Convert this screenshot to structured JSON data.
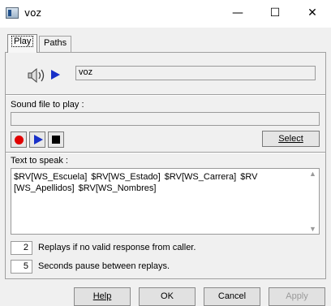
{
  "window": {
    "title": "voz",
    "minimize_glyph": "—",
    "maximize_glyph": "☐",
    "close_glyph": "✕"
  },
  "tabs": [
    {
      "label": "Play",
      "active": true
    },
    {
      "label": "Paths",
      "active": false
    }
  ],
  "play": {
    "speaker_icon": "speaker-icon",
    "name_value": "voz",
    "sound_file_label": "Sound file to play :",
    "sound_file_value": "",
    "select_label": "Select",
    "text_to_speak_label": "Text to speak :",
    "text_to_speak_value": "$RV[WS_Escuela]   $RV[WS_Estado]  $RV[WS_Carrera]  $RV [WS_Apellidos]   $RV[WS_Nombres]",
    "replays_value": "2",
    "replays_label": "Replays if no valid response from caller.",
    "pause_value": "5",
    "pause_label": "Seconds pause between replays."
  },
  "footer": {
    "help_label": "Help",
    "ok_label": "OK",
    "cancel_label": "Cancel",
    "apply_label": "Apply"
  },
  "colors": {
    "accent_play": "#1830c8",
    "record": "#e00000",
    "dialog_bg": "#f0f0f0"
  }
}
